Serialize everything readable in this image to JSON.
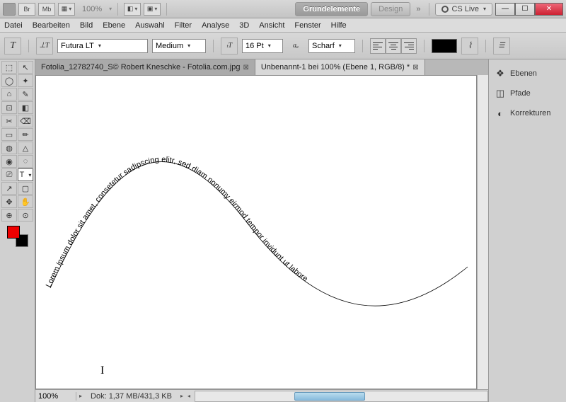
{
  "titlebar": {
    "app_icon": "Ps",
    "boxes": [
      "Br",
      "Mb"
    ],
    "zoom": "100%",
    "workspace_active": "Grundelemente",
    "workspace_other": "Design",
    "cslive": "CS Live"
  },
  "menu": [
    "Datei",
    "Bearbeiten",
    "Bild",
    "Ebene",
    "Auswahl",
    "Filter",
    "Analyse",
    "3D",
    "Ansicht",
    "Fenster",
    "Hilfe"
  ],
  "options": {
    "font": "Futura LT",
    "weight": "Medium",
    "size": "16 Pt",
    "aa": "Scharf"
  },
  "tabs": [
    {
      "label": "Fotolia_12782740_S© Robert Kneschke - Fotolia.com.jpg",
      "active": false
    },
    {
      "label": "Unbenannt-1 bei 100% (Ebene 1, RGB/8) *",
      "active": true
    }
  ],
  "panels": [
    {
      "icon": "❖",
      "label": "Ebenen"
    },
    {
      "icon": "◫",
      "label": "Pfade"
    },
    {
      "icon": "◐",
      "label": "Korrekturen"
    }
  ],
  "status": {
    "zoom": "100%",
    "info": "Dok: 1,37 MB/431,3 KB"
  },
  "canvas": {
    "path_text": "Lorem ipsum dolor sit amet, consetetur sadipscing elitr, sed diam nonumy eirmod tempor invidunt ut labore"
  },
  "tools": [
    "⬚",
    "↖",
    "◯",
    "✦",
    "⌂",
    "✎",
    "⊡",
    "◧",
    "✂",
    "⌫",
    "▭",
    "✏",
    "◍",
    "△",
    "◉",
    "◌",
    "⎚",
    "T",
    "↗",
    "▢",
    "✥",
    "✋",
    "⊕",
    "⊙"
  ]
}
